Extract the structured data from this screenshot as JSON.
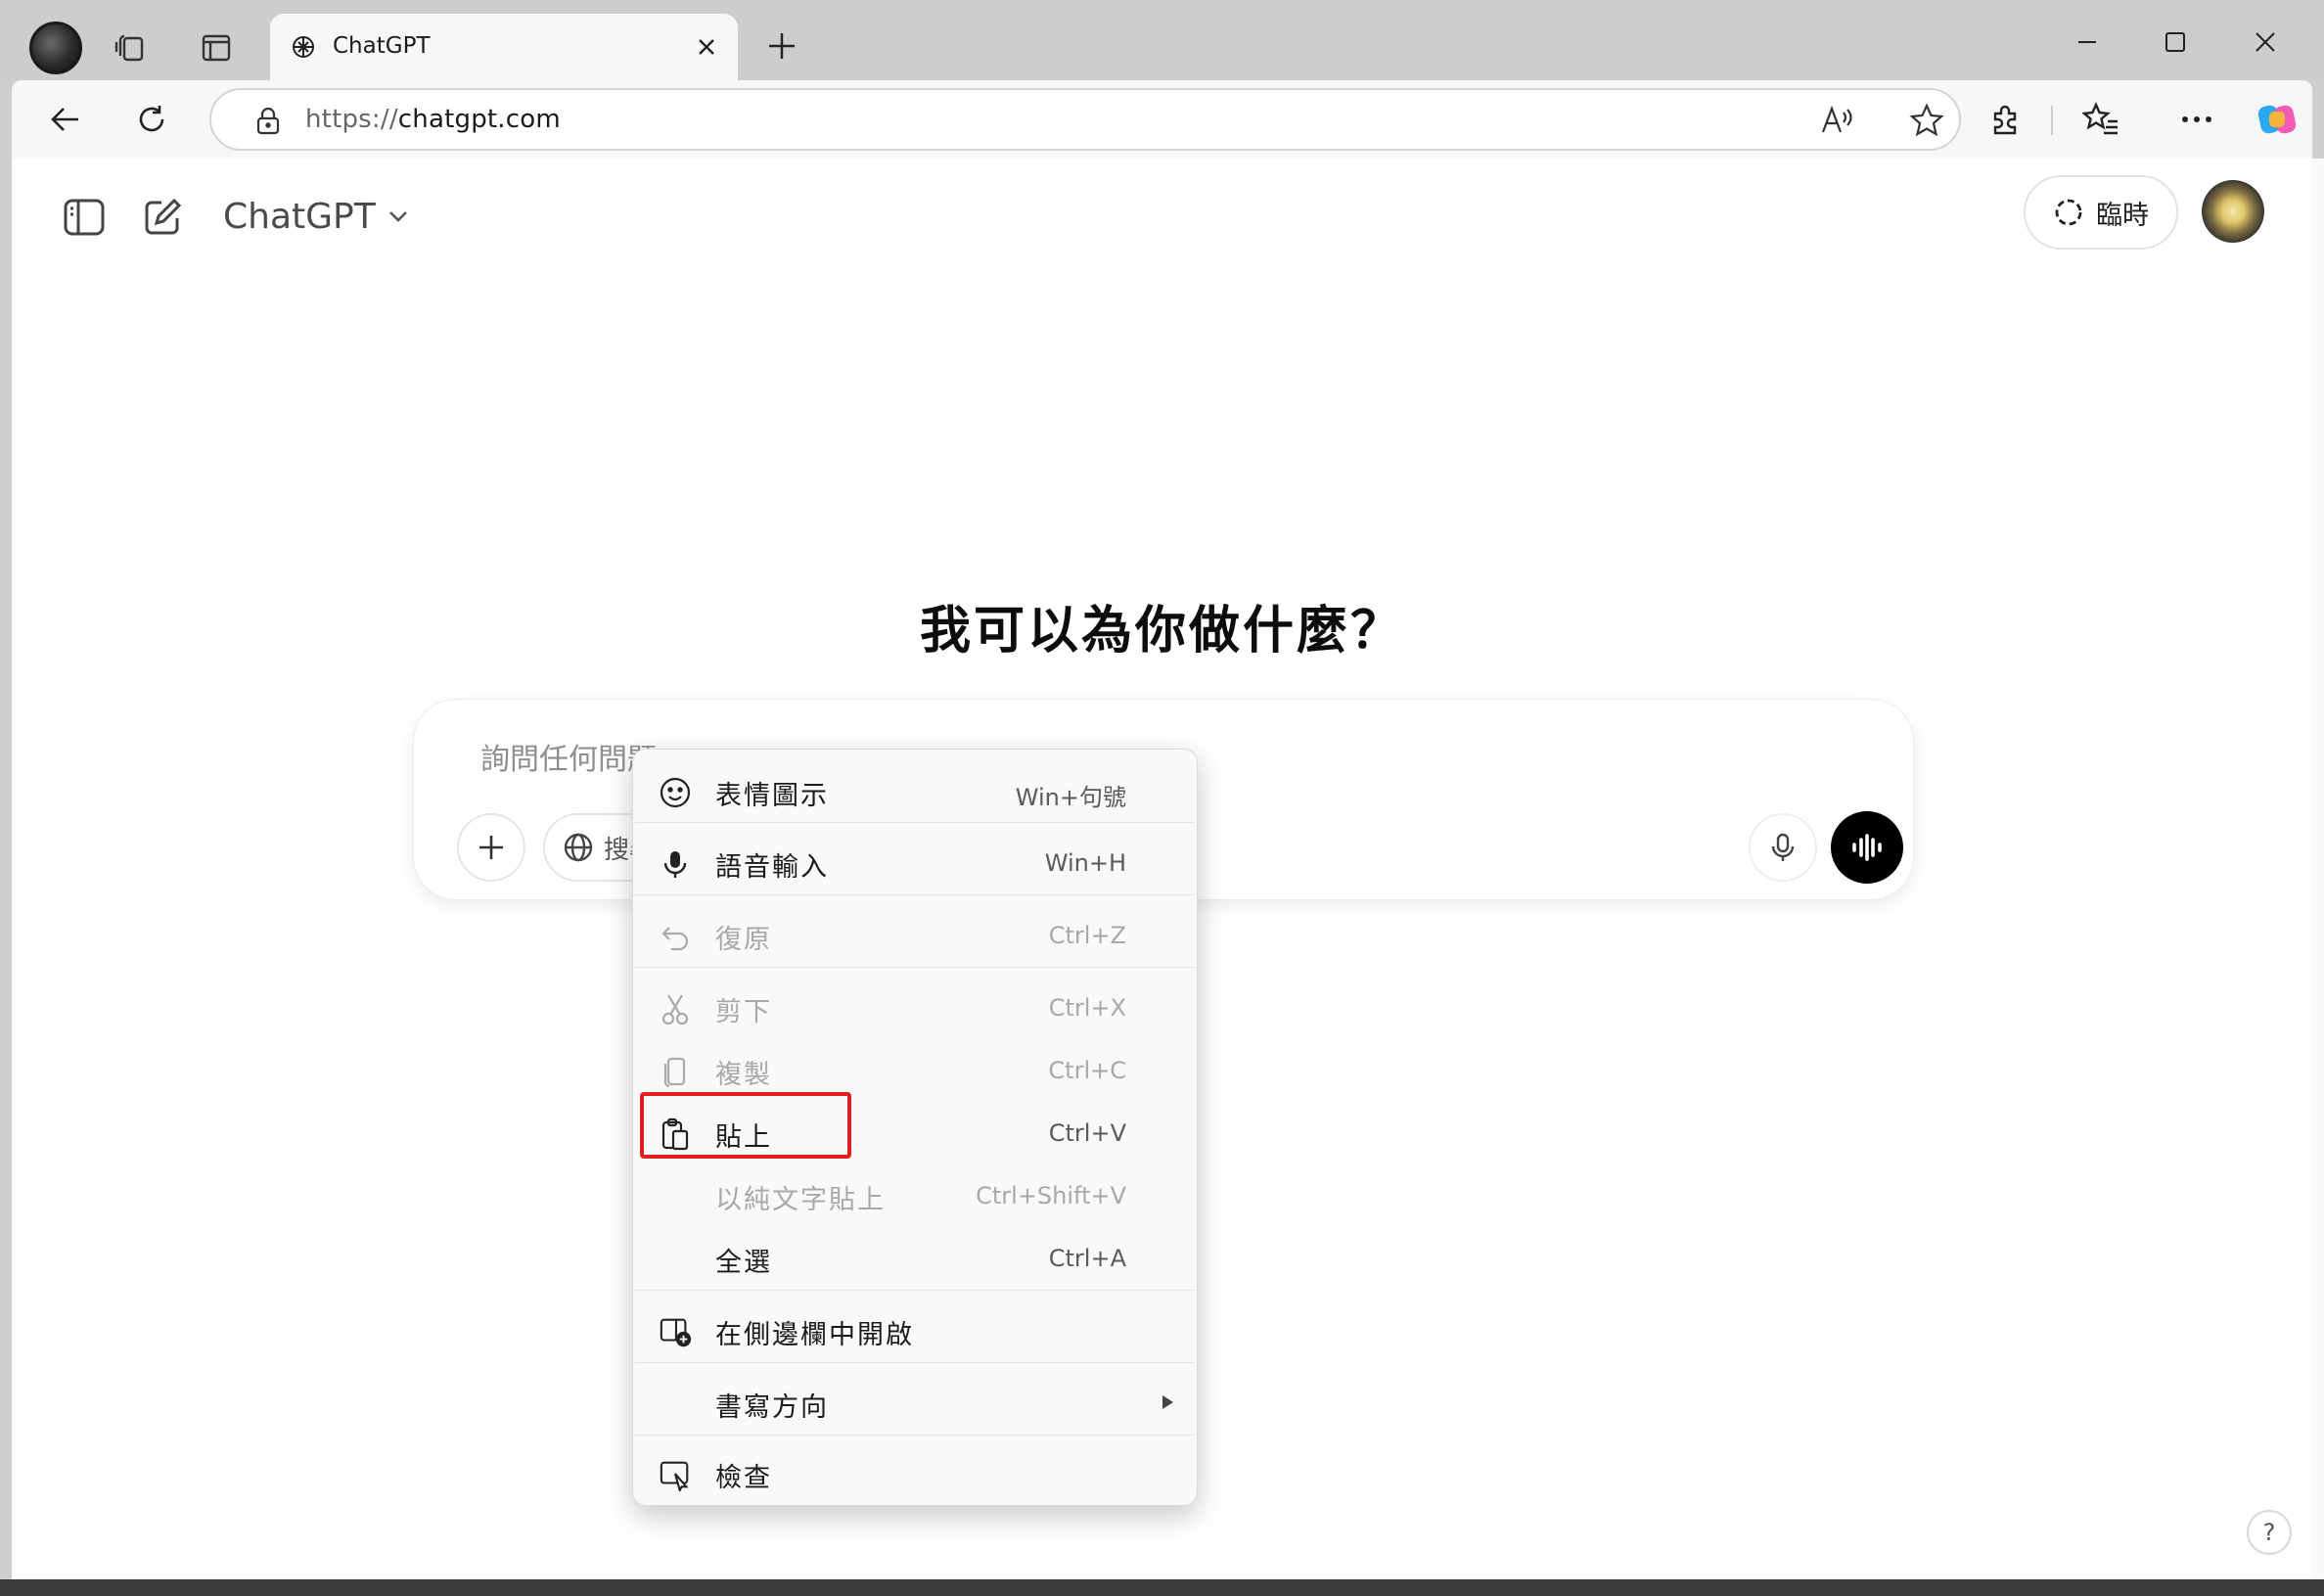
{
  "browser": {
    "tab": {
      "title": "ChatGPT"
    },
    "url": {
      "protocol": "https://",
      "host": "chatgpt.com"
    }
  },
  "page": {
    "model_name": "ChatGPT",
    "temporary_label": "臨時",
    "headline": "我可以為你做什麼？",
    "composer": {
      "placeholder": "詢問任何問題",
      "search_label": "搜尋"
    },
    "help_label": "?"
  },
  "context_menu": {
    "items": [
      {
        "label": "表情圖示",
        "shortcut": "Win+句號",
        "icon": "emoji-icon",
        "enabled": true
      },
      {
        "label": "語音輸入",
        "shortcut": "Win+H",
        "icon": "microphone-icon",
        "enabled": true
      },
      {
        "label": "復原",
        "shortcut": "Ctrl+Z",
        "icon": "undo-icon",
        "enabled": false
      },
      {
        "label": "剪下",
        "shortcut": "Ctrl+X",
        "icon": "scissors-icon",
        "enabled": false
      },
      {
        "label": "複製",
        "shortcut": "Ctrl+C",
        "icon": "copy-icon",
        "enabled": false
      },
      {
        "label": "貼上",
        "shortcut": "Ctrl+V",
        "icon": "clipboard-icon",
        "enabled": true,
        "highlighted": true
      },
      {
        "label": "以純文字貼上",
        "shortcut": "Ctrl+Shift+V",
        "icon": "",
        "enabled": false
      },
      {
        "label": "全選",
        "shortcut": "Ctrl+A",
        "icon": "",
        "enabled": true
      },
      {
        "label": "在側邊欄中開啟",
        "shortcut": "",
        "icon": "sidebar-open-icon",
        "enabled": true
      },
      {
        "label": "書寫方向",
        "shortcut": "",
        "icon": "",
        "enabled": true,
        "submenu": true
      },
      {
        "label": "檢查",
        "shortcut": "",
        "icon": "inspect-icon",
        "enabled": true
      }
    ]
  },
  "colors": {
    "highlight": "#e02020",
    "voice_button": "#000000"
  }
}
